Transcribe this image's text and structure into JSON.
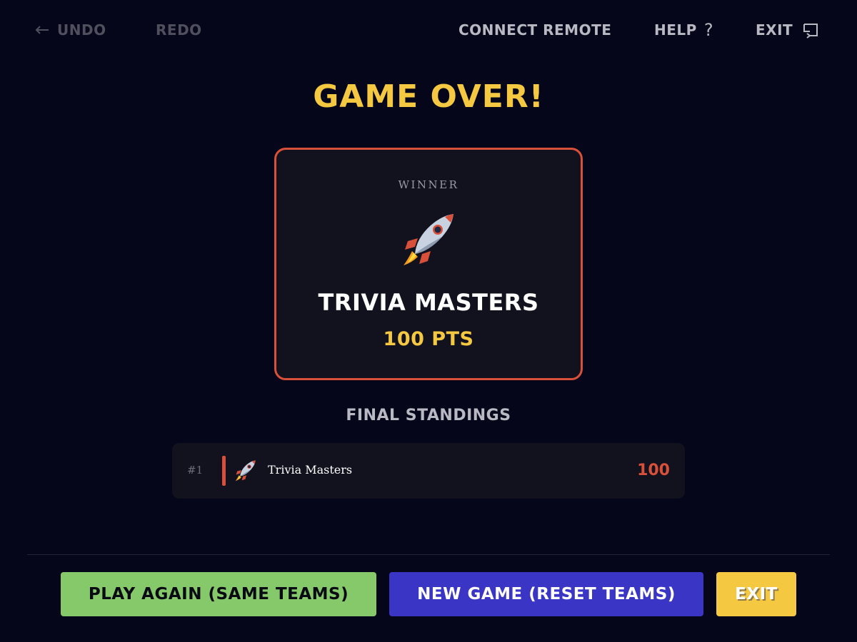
{
  "topbar": {
    "undo_label": "UNDO",
    "redo_label": "REDO",
    "connect_label": "CONNECT REMOTE",
    "help_label": "HELP",
    "help_icon": "?",
    "exit_label": "EXIT"
  },
  "title": "GAME OVER!",
  "winner": {
    "label": "WINNER",
    "emoji": "rocket-icon",
    "name": "TRIVIA MASTERS",
    "points": "100 PTS"
  },
  "standings": {
    "title": "FINAL STANDINGS",
    "rows": [
      {
        "rank": "#1",
        "emoji": "rocket-icon",
        "name": "Trivia Masters",
        "score": "100"
      }
    ]
  },
  "buttons": {
    "play_again": "PLAY AGAIN (SAME TEAMS)",
    "new_game": "NEW GAME (RESET TEAMS)",
    "exit": "EXIT"
  },
  "colors": {
    "background": "#06061a",
    "accent_yellow": "#f5c842",
    "accent_red": "#d9503a",
    "green": "#85c96a",
    "blue": "#3b35c6"
  }
}
